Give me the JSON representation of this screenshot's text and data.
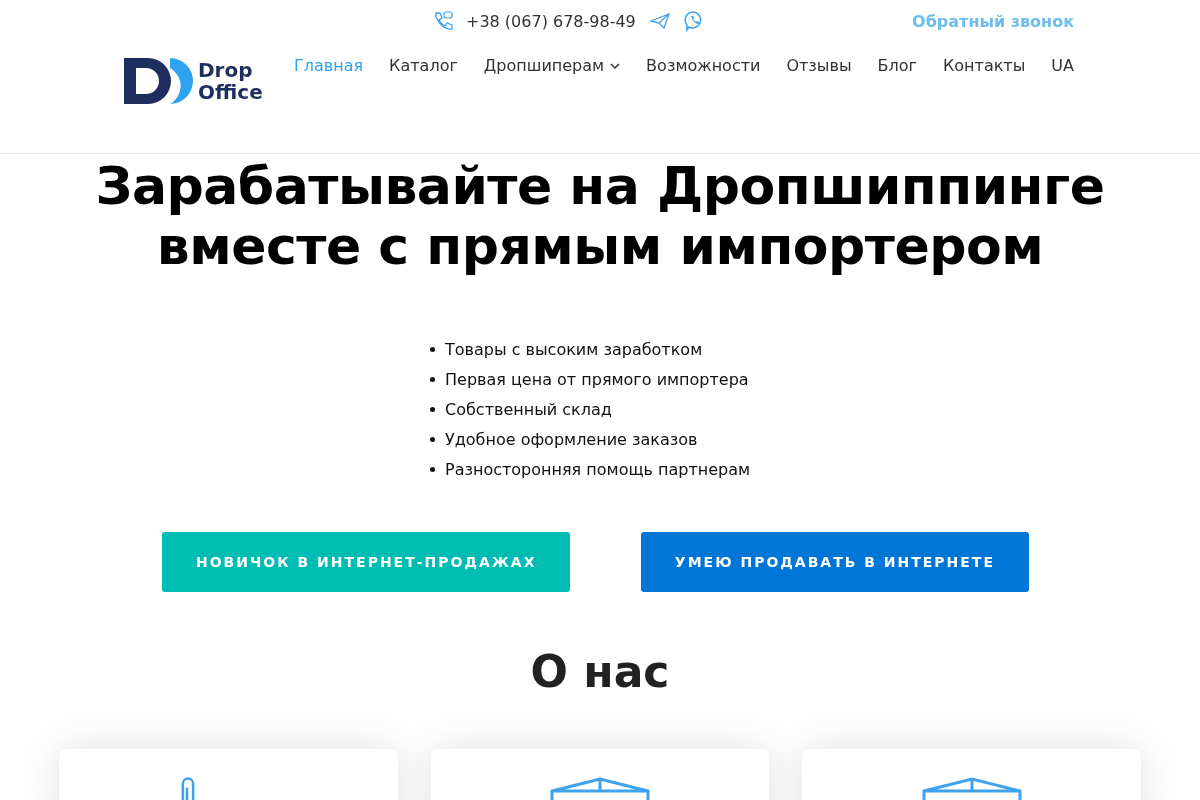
{
  "topbar": {
    "phone": "+38 (067) 678-98-49",
    "callback": "Обратный звонок"
  },
  "logo": {
    "line1": "Drop",
    "line2": "Office"
  },
  "nav": [
    {
      "label": "Главная",
      "selected": true,
      "dropdown": false
    },
    {
      "label": "Каталог",
      "selected": false,
      "dropdown": false
    },
    {
      "label": "Дропшиперам",
      "selected": false,
      "dropdown": true
    },
    {
      "label": "Возможности",
      "selected": false,
      "dropdown": false
    },
    {
      "label": "Отзывы",
      "selected": false,
      "dropdown": false
    },
    {
      "label": "Блог",
      "selected": false,
      "dropdown": false
    },
    {
      "label": "Контакты",
      "selected": false,
      "dropdown": false
    },
    {
      "label": "UA",
      "selected": false,
      "dropdown": false
    }
  ],
  "hero": {
    "title_lines": [
      "Зарабатывайте на Дропшиппинге",
      "вместе с прямым импортером"
    ],
    "benefits": [
      "Товары с высоким заработком",
      "Первая цена от прямого импортера",
      "Собственный склад",
      "Удобное оформление заказов",
      "Разносторонняя помощь партнерам"
    ],
    "buttons": [
      {
        "label": "НОВИЧОК В ИНТЕРНЕТ-ПРОДАЖАХ",
        "color": "#00bdb4"
      },
      {
        "label": "УМЕЮ ПРОДАВАТЬ В ИНТЕРНЕТЕ",
        "color": "#0077d6"
      }
    ]
  },
  "about": {
    "heading": "О нас",
    "cards": [
      {
        "kind": "clip"
      },
      {
        "kind": "box"
      },
      {
        "kind": "box"
      }
    ]
  }
}
